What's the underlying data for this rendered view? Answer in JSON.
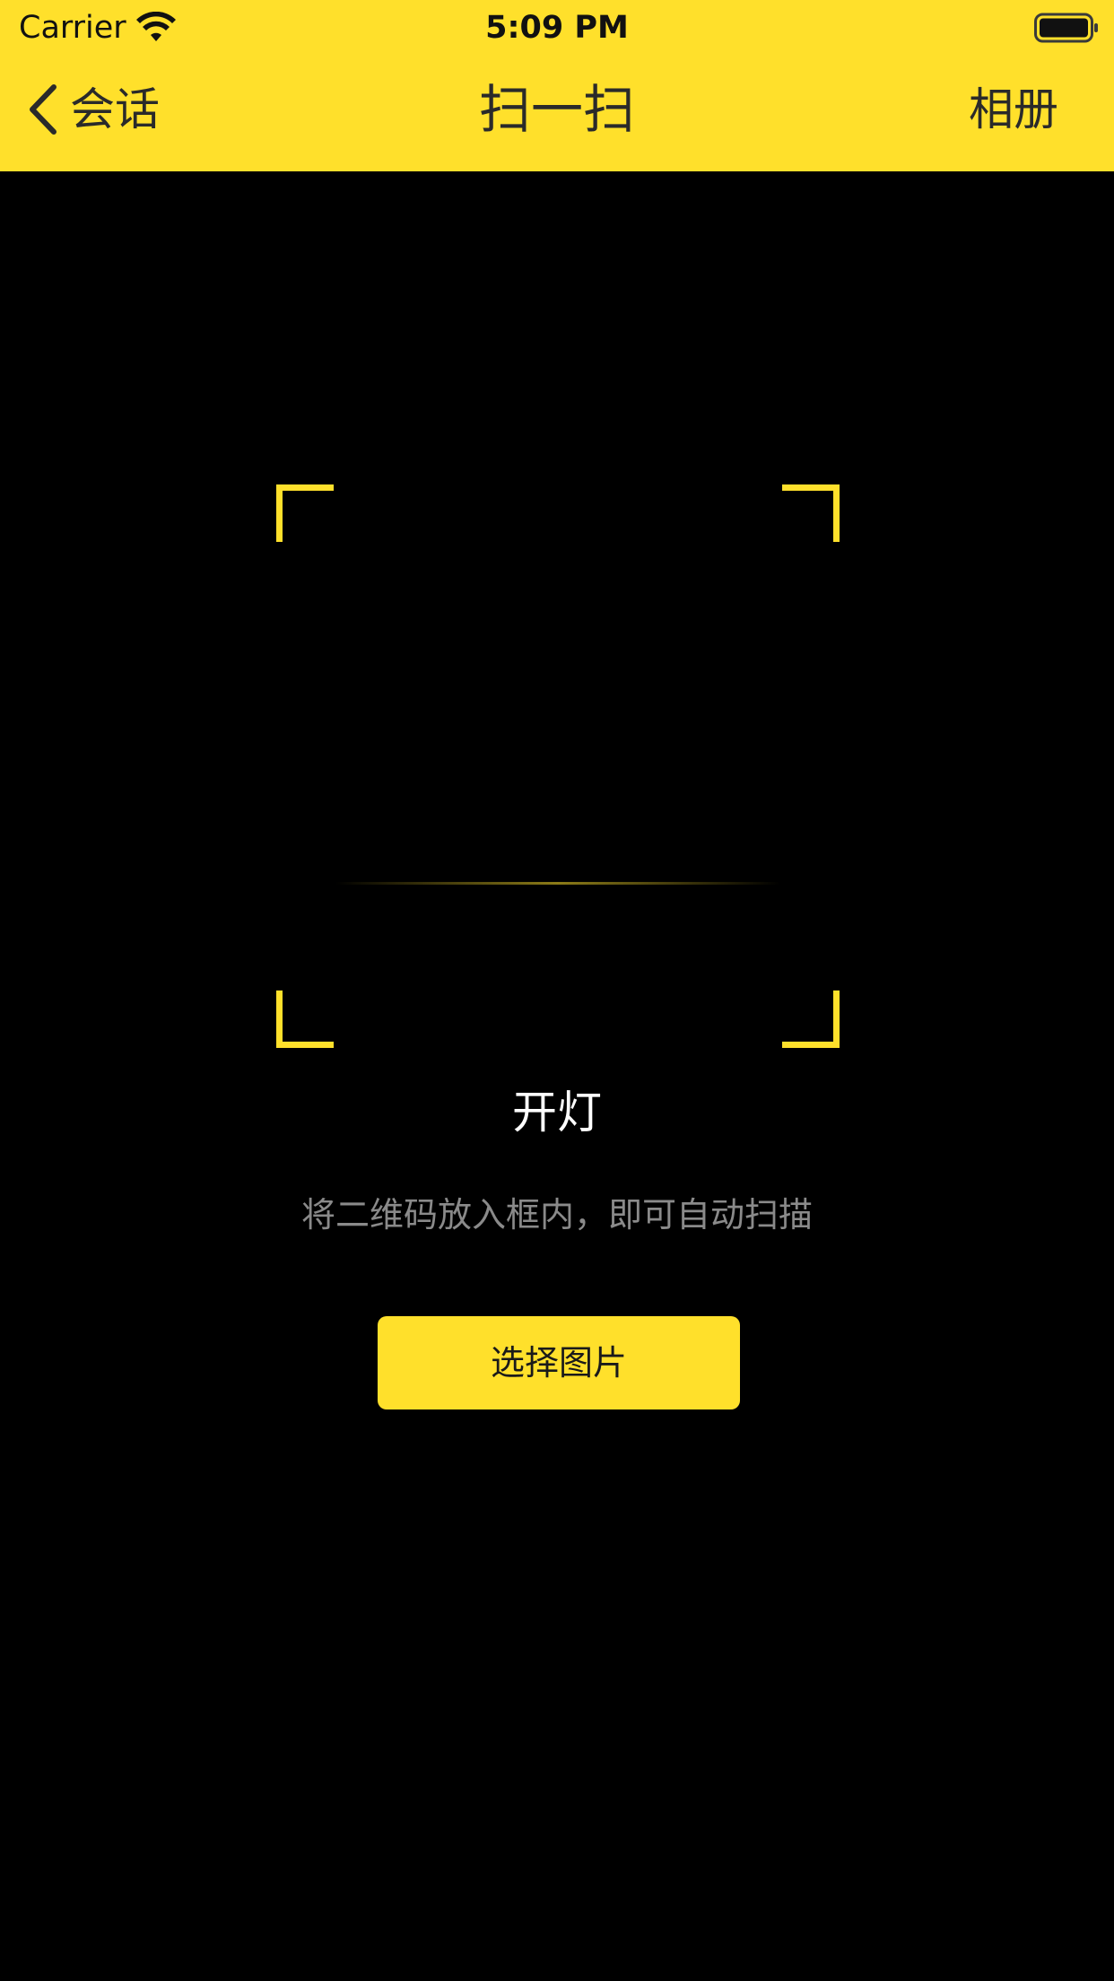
{
  "status_bar": {
    "carrier": "Carrier",
    "time": "5:09 PM",
    "wifi_icon": "wifi-icon",
    "battery_icon": "battery-full-icon"
  },
  "nav": {
    "back_label": "会话",
    "back_icon": "chevron-left-icon",
    "title": "扫一扫",
    "album_label": "相册"
  },
  "scanner": {
    "light_label": "开灯",
    "hint": "将二维码放入框内，即可自动扫描",
    "select_image_label": "选择图片"
  },
  "colors": {
    "accent": "#FFE02B",
    "background": "#000000",
    "hint_text": "#8A8A8A"
  }
}
